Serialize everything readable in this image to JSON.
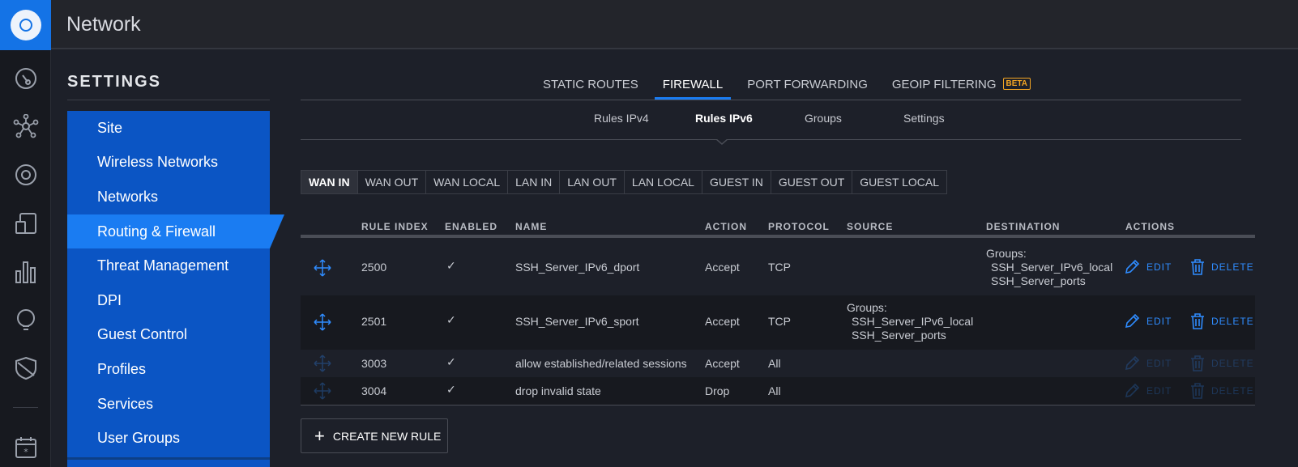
{
  "app": {
    "title": "Network"
  },
  "rail": {
    "icons": [
      "dashboard-icon",
      "topology-icon",
      "devices-icon",
      "clients-icon",
      "statistics-icon",
      "insights-icon",
      "shield-icon",
      "events-icon"
    ]
  },
  "settings": {
    "heading": "SETTINGS",
    "items": [
      {
        "label": "Site"
      },
      {
        "label": "Wireless Networks"
      },
      {
        "label": "Networks"
      },
      {
        "label": "Routing & Firewall"
      },
      {
        "label": "Threat Management"
      },
      {
        "label": "DPI"
      },
      {
        "label": "Guest Control"
      },
      {
        "label": "Profiles"
      },
      {
        "label": "Services"
      },
      {
        "label": "User Groups"
      }
    ],
    "active_index": 3
  },
  "tabs": {
    "items": [
      {
        "label": "STATIC ROUTES"
      },
      {
        "label": "FIREWALL"
      },
      {
        "label": "PORT FORWARDING"
      },
      {
        "label": "GEOIP FILTERING"
      }
    ],
    "active_index": 1,
    "beta_badge": "BETA"
  },
  "subtabs": {
    "items": [
      {
        "label": "Rules IPv4"
      },
      {
        "label": "Rules IPv6"
      },
      {
        "label": "Groups"
      },
      {
        "label": "Settings"
      }
    ],
    "active_index": 1
  },
  "segments": {
    "items": [
      {
        "label": "WAN IN"
      },
      {
        "label": "WAN OUT"
      },
      {
        "label": "WAN LOCAL"
      },
      {
        "label": "LAN IN"
      },
      {
        "label": "LAN OUT"
      },
      {
        "label": "LAN LOCAL"
      },
      {
        "label": "GUEST IN"
      },
      {
        "label": "GUEST OUT"
      },
      {
        "label": "GUEST LOCAL"
      }
    ],
    "active_index": 0
  },
  "table": {
    "headers": {
      "rule_index": "RULE INDEX",
      "enabled": "ENABLED",
      "name": "NAME",
      "action": "ACTION",
      "protocol": "PROTOCOL",
      "source": "SOURCE",
      "destination": "DESTINATION",
      "actions": "ACTIONS"
    },
    "rows": [
      {
        "index": "2500",
        "enabled": "✓",
        "name": "SSH_Server_IPv6_dport",
        "action": "Accept",
        "protocol": "TCP",
        "source_label": "",
        "source_items": [],
        "dest_label": "Groups:",
        "dest_items": [
          "SSH_Server_IPv6_local",
          "SSH_Server_ports"
        ],
        "edit": "EDIT",
        "delete": "DELETE"
      },
      {
        "index": "2501",
        "enabled": "✓",
        "name": "SSH_Server_IPv6_sport",
        "action": "Accept",
        "protocol": "TCP",
        "source_label": "Groups:",
        "source_items": [
          "SSH_Server_IPv6_local",
          "SSH_Server_ports"
        ],
        "dest_label": "",
        "dest_items": [],
        "edit": "EDIT",
        "delete": "DELETE"
      },
      {
        "index": "3003",
        "enabled": "✓",
        "name": "allow established/related sessions",
        "action": "Accept",
        "protocol": "All",
        "edit": "EDIT",
        "delete": "DELETE"
      },
      {
        "index": "3004",
        "enabled": "✓",
        "name": "drop invalid state",
        "action": "Drop",
        "protocol": "All",
        "edit": "EDIT",
        "delete": "DELETE"
      }
    ]
  },
  "create_button": {
    "label": "CREATE NEW RULE"
  },
  "colors": {
    "accent": "#1a7cf2",
    "menu_bg": "#0b55c4",
    "link": "#2f8cff",
    "beta": "#f5a623"
  }
}
